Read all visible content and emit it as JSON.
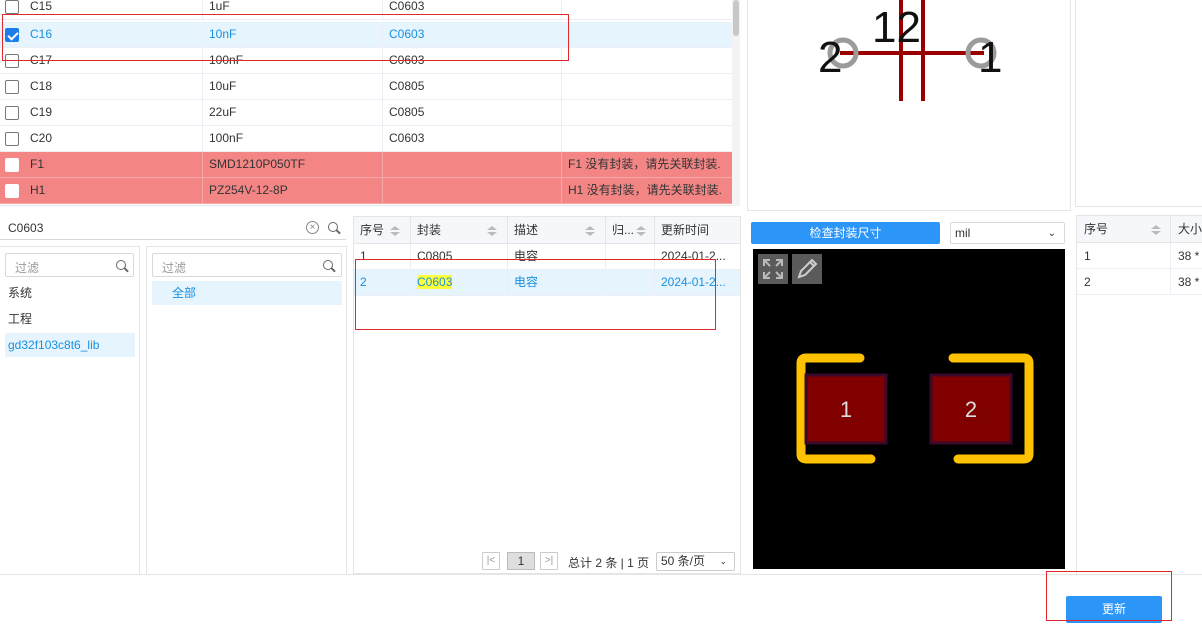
{
  "components": [
    {
      "designator": "C15",
      "value": "1uF",
      "footprint": "C0603",
      "note": "",
      "checked": false,
      "state": "normal"
    },
    {
      "designator": "C16",
      "value": "10nF",
      "footprint": "C0603",
      "note": "",
      "checked": true,
      "state": "selected"
    },
    {
      "designator": "C17",
      "value": "100nF",
      "footprint": "C0603",
      "note": "",
      "checked": false,
      "state": "normal"
    },
    {
      "designator": "C18",
      "value": "10uF",
      "footprint": "C0805",
      "note": "",
      "checked": false,
      "state": "normal"
    },
    {
      "designator": "C19",
      "value": "22uF",
      "footprint": "C0805",
      "note": "",
      "checked": false,
      "state": "normal"
    },
    {
      "designator": "C20",
      "value": "100nF",
      "footprint": "C0603",
      "note": "",
      "checked": false,
      "state": "normal"
    },
    {
      "designator": "F1",
      "value": "SMD1210P050TF",
      "footprint": "",
      "note": "F1 没有封装，请先关联封装.",
      "checked": false,
      "state": "error"
    },
    {
      "designator": "H1",
      "value": "PZ254V-12-8P",
      "footprint": "",
      "note": "H1 没有封装，请先关联封装.",
      "checked": false,
      "state": "error"
    }
  ],
  "symbol_preview": {
    "pin_left": "2",
    "pin_right": "1",
    "pin_numbers_top": "12"
  },
  "search": {
    "value": "C0603"
  },
  "library_panel": {
    "filter_placeholder": "过滤",
    "items": [
      {
        "label": "系统",
        "selected": false
      },
      {
        "label": "工程",
        "selected": false
      },
      {
        "label": "gd32f103c8t6_lib",
        "selected": true
      }
    ]
  },
  "category_panel": {
    "filter_placeholder": "过滤",
    "items": [
      {
        "label": "全部",
        "selected": true
      }
    ]
  },
  "footprint_table": {
    "headers": [
      "序号",
      "封装",
      "描述",
      "归...",
      "更新时间"
    ],
    "rows": [
      {
        "index": "1",
        "name": "C0805",
        "desc": "电容",
        "owner": "",
        "updated": "2024-01-2...",
        "selected": false,
        "highlight": false
      },
      {
        "index": "2",
        "name": "C0603",
        "desc": "电容",
        "owner": "",
        "updated": "2024-01-2...",
        "selected": true,
        "highlight": true
      }
    ]
  },
  "pager": {
    "current_page": "1",
    "summary": "总计 2 条 | 1 页",
    "page_size": "50 条/页"
  },
  "footprint_preview": {
    "check_button": "检查封装尺寸",
    "unit": "mil",
    "pads": [
      "1",
      "2"
    ],
    "colors": {
      "background": "#000000",
      "pad": "#800000",
      "silkscreen": "#ffc200",
      "toolbar": "#5a5a5a"
    }
  },
  "pad_table": {
    "headers": [
      "序号",
      "大小"
    ],
    "rows": [
      {
        "index": "1",
        "size": "38 *"
      },
      {
        "index": "2",
        "size": "38 *"
      }
    ]
  },
  "update_button": "更新",
  "colors": {
    "accent": "#2b95f8",
    "selected_row": "#e6f4fd",
    "error_row": "#f38585",
    "annotation": "#e0282e",
    "match_highlight": "#ffff3a"
  }
}
